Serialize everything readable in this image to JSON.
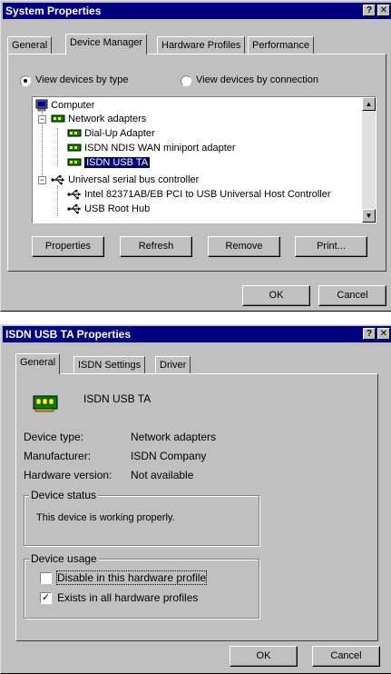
{
  "sys_props": {
    "title": "System Properties",
    "help_btn": "?",
    "close_btn": "✕",
    "tabs": [
      "General",
      "Device Manager",
      "Hardware Profiles",
      "Performance"
    ],
    "radio_by_type": "View devices by type",
    "radio_by_connection": "View devices by connection",
    "tree": {
      "computer": "Computer",
      "network_adapters": "Network adapters",
      "dialup": "Dial-Up Adapter",
      "isdn_ndis": "ISDN NDIS WAN miniport adapter",
      "isdn_usb": "ISDN USB TA",
      "usb_controller": "Universal serial bus controller",
      "intel_usb": "Intel 82371AB/EB PCI to USB Universal Host Controller",
      "usb_root": "USB Root Hub"
    },
    "buttons": {
      "properties": "Properties",
      "refresh": "Refresh",
      "remove": "Remove",
      "print": "Print..."
    },
    "ok": "OK",
    "cancel": "Cancel"
  },
  "isdn_props": {
    "title": "ISDN USB TA Properties",
    "help_btn": "?",
    "close_btn": "✕",
    "tabs": [
      "General",
      "ISDN Settings",
      "Driver"
    ],
    "device_name": "ISDN USB TA",
    "device_type_label": "Device type:",
    "device_type_value": "Network adapters",
    "manufacturer_label": "Manufacturer:",
    "manufacturer_value": "ISDN Company",
    "hw_version_label": "Hardware version:",
    "hw_version_value": "Not available",
    "status_group": "Device status",
    "status_text": "This device is working properly.",
    "usage_group": "Device usage",
    "disable_label": "Disable in this hardware profile",
    "disable_checked": false,
    "exists_label": "Exists in all hardware profiles",
    "exists_checked": true,
    "ok": "OK",
    "cancel": "Cancel"
  },
  "colors": {
    "titlebar": "#000080",
    "face": "#c0c0c0",
    "selection": "#000080"
  }
}
